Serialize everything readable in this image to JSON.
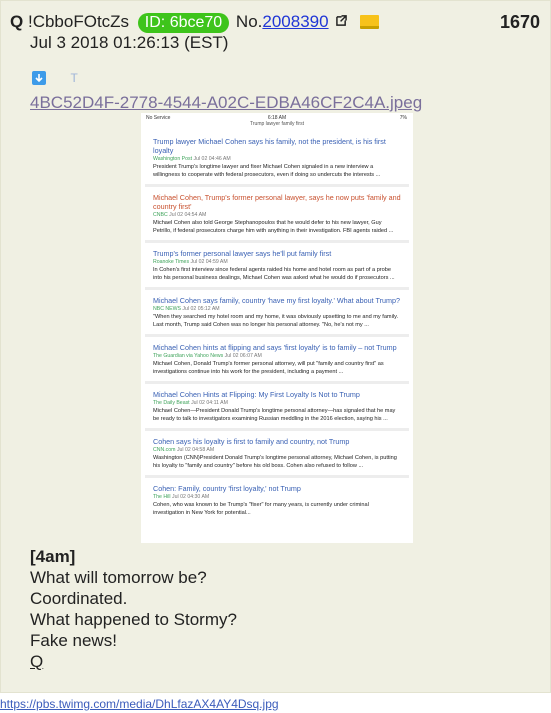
{
  "post": {
    "name": "Q",
    "tripcode": "!CbboFOtcZs",
    "id_label": "ID: 6bce70",
    "no_prefix": "No.",
    "number": "2008390",
    "count": "1670",
    "date": "Jul 3 2018 01:26:13 (EST)",
    "filename": "4BC52D4F-2778-4544-A02C-EDBA46CF2C4A.jpeg",
    "lines": [
      "[4am]",
      "What will tomorrow be?",
      "Coordinated.",
      "What happened to Stormy?",
      "Fake news!",
      "Q"
    ],
    "source_url": "https://pbs.twimg.com/media/DhLfazAX4AY4Dsq.jpg"
  },
  "screenshot": {
    "status_left": "No Service",
    "status_time": "6:18 AM",
    "status_right": "7%",
    "url": "Trump lawyer family first",
    "results": [
      {
        "title": "Trump lawyer Michael Cohen says his family, not the president, is his first loyalty",
        "source": "Washington Post",
        "time": "Jul 02 04:46 AM",
        "snippet": "President Trump's longtime lawyer and fixer Michael Cohen signaled in a new interview a willingness to cooperate with federal prosecutors, even if doing so undercuts the interests ..."
      },
      {
        "title": "Michael Cohen, Trump's former personal lawyer, says he now puts 'family and country first'",
        "source": "CNBC",
        "time": "Jul 02 04:54 AM",
        "snippet": "Michael Cohen also told George Stephanopoulos that he would defer to his new lawyer, Guy Petrillo, if federal prosecutors charge him with anything in their investigation. FBI agents raided ..."
      },
      {
        "title": "Trump's former personal lawyer says he'll put family first",
        "source": "Roanoke Times",
        "time": "Jul 02 04:59 AM",
        "snippet": "In Cohen's first interview since federal agents raided his home and hotel room as part of a probe into his personal business dealings, Michael Cohen was asked what he would do if prosecutors ..."
      },
      {
        "title": "Michael Cohen says family, country 'have my first loyalty.' What about Trump?",
        "source": "NBC NEWS",
        "time": "Jul 02 05:12 AM",
        "snippet": "\"When they searched my hotel room and my home, it was obviously upsetting to me and my family. Last month, Trump said Cohen was no longer his personal attorney. \"No, he's not my ..."
      },
      {
        "title": "Michael Cohen hints at flipping and says 'first loyalty' is to family – not Trump",
        "source": "The Guardian via Yahoo News",
        "time": "Jul 02 06:07 AM",
        "snippet": "Michael Cohen, Donald Trump's former personal attorney, will put \"family and country first\" as investigations continue into his work for the president, including a payment ..."
      },
      {
        "title": "Michael Cohen Hints at Flipping: My First Loyalty Is Not to Trump",
        "source": "The Daily Beast",
        "time": "Jul 02 04:11 AM",
        "snippet": "Michael Cohen—President Donald Trump's longtime personal attorney—has signaled that he may be ready to talk to investigators examining Russian meddling in the 2016 election, saying his ..."
      },
      {
        "title": "Cohen says his loyalty is first to family and country, not Trump",
        "source": "CNN.com",
        "time": "Jul 02 04:58 AM",
        "snippet": "Washington (CNN)President Donald Trump's longtime personal attorney, Michael Cohen, is putting his loyalty to \"family and country\" before his old boss. Cohen also refused to follow ..."
      },
      {
        "title": "Cohen: Family, country 'first loyalty,' not Trump",
        "source": "The Hill",
        "time": "Jul 02 04:30 AM",
        "snippet": "Cohen, who was known to be Trump's \"fixer\" for many years, is currently under criminal investigation in New York for potential..."
      }
    ]
  },
  "colors": {
    "post_bg": "#f0f0e3",
    "id_badge": "#3ec41b",
    "link": "#2036d6",
    "result_title": "#3a61b4",
    "result_title_alt": "#c8502e",
    "result_source": "#3ea35a"
  }
}
